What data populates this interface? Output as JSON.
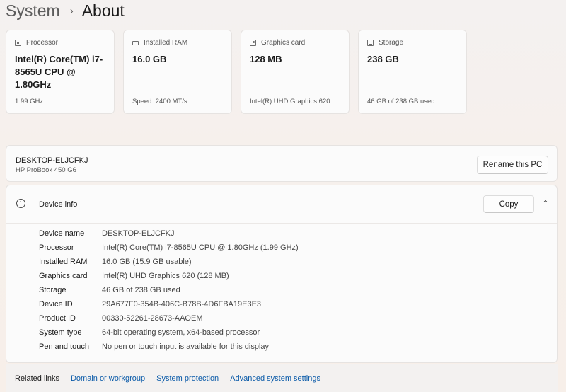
{
  "breadcrumb": {
    "parent": "System",
    "separator": "›",
    "current": "About"
  },
  "cards": [
    {
      "label": "Processor",
      "value": "Intel(R) Core(TM) i7-8565U CPU @ 1.80GHz",
      "sub": "1.99 GHz",
      "icon": "processor-icon"
    },
    {
      "label": "Installed RAM",
      "value": "16.0 GB",
      "sub": "Speed: 2400 MT/s",
      "icon": "ram-icon"
    },
    {
      "label": "Graphics card",
      "value": "128 MB",
      "sub": "Intel(R) UHD Graphics 620",
      "icon": "graphics-card-icon"
    },
    {
      "label": "Storage",
      "value": "238 GB",
      "sub": "46 GB of 238 GB used",
      "icon": "storage-icon"
    }
  ],
  "pc": {
    "name": "DESKTOP-ELJCFKJ",
    "model": "HP ProBook 450 G6",
    "rename_label": "Rename this PC"
  },
  "device_info": {
    "title": "Device info",
    "copy_label": "Copy",
    "specs": [
      {
        "label": "Device name",
        "value": "DESKTOP-ELJCFKJ"
      },
      {
        "label": "Processor",
        "value": "Intel(R) Core(TM) i7-8565U CPU @ 1.80GHz (1.99 GHz)"
      },
      {
        "label": "Installed RAM",
        "value": "16.0 GB (15.9 GB usable)"
      },
      {
        "label": "Graphics card",
        "value": "Intel(R) UHD Graphics 620 (128 MB)"
      },
      {
        "label": "Storage",
        "value": "46 GB of 238 GB used"
      },
      {
        "label": "Device ID",
        "value": "29A677F0-354B-406C-B78B-4D6FBA19E3E3"
      },
      {
        "label": "Product ID",
        "value": "00330-52261-28673-AAOEM"
      },
      {
        "label": "System type",
        "value": "64-bit operating system, x64-based processor"
      },
      {
        "label": "Pen and touch",
        "value": "No pen or touch input is available for this display"
      }
    ]
  },
  "related": {
    "title": "Related links",
    "links": [
      "Domain or workgroup",
      "System protection",
      "Advanced system settings"
    ]
  }
}
